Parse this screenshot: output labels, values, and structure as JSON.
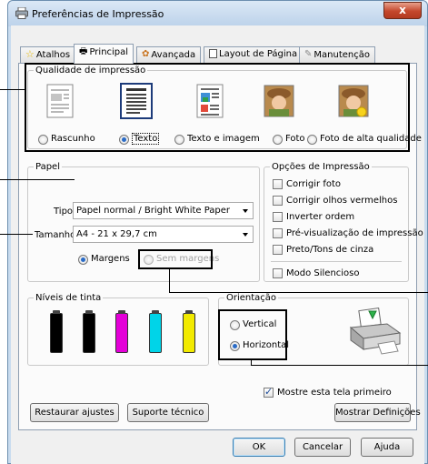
{
  "window": {
    "title": "Preferências de Impressão",
    "close": "x"
  },
  "tabs": [
    {
      "label": "Atalhos",
      "icon": "star-icon"
    },
    {
      "label": "Principal",
      "icon": "printer-icon"
    },
    {
      "label": "Avançada",
      "icon": "advanced-icon"
    },
    {
      "label": "Layout de Página",
      "icon": "page-layout-icon"
    },
    {
      "label": "Manutenção",
      "icon": "maintenance-icon"
    }
  ],
  "quality": {
    "legend": "Qualidade de impressão",
    "options": [
      {
        "label": "Rascunho",
        "selected": false
      },
      {
        "label": "Texto",
        "selected": true
      },
      {
        "label": "Texto e imagem",
        "selected": false
      },
      {
        "label": "Foto",
        "selected": false
      },
      {
        "label": "Foto de alta qualidade",
        "selected": false
      }
    ]
  },
  "paper": {
    "legend": "Papel",
    "type_label": "Tipo",
    "type_value": "Papel normal / Bright White Paper",
    "size_label": "Tamanho",
    "size_value": "A4 - 21 x 29,7 cm",
    "margins": "Margens",
    "no_margins": "Sem margens"
  },
  "print_options": {
    "legend": "Opções de Impressão",
    "items": [
      {
        "label": "Corrigir foto",
        "checked": false
      },
      {
        "label": "Corrigir olhos vermelhos",
        "checked": false
      },
      {
        "label": "Inverter ordem",
        "checked": false
      },
      {
        "label": "Pré-visualização de impressão",
        "checked": false
      },
      {
        "label": "Preto/Tons de cinza",
        "checked": false
      }
    ],
    "silent": {
      "label": "Modo Silencioso",
      "checked": false
    }
  },
  "ink": {
    "legend": "Níveis de tinta",
    "cartridges": [
      {
        "color": "#000000"
      },
      {
        "color": "#000000"
      },
      {
        "color": "#e400d8"
      },
      {
        "color": "#00d4e8"
      },
      {
        "color": "#f2ea00"
      }
    ]
  },
  "orientation": {
    "legend": "Orientação",
    "vertical": "Vertical",
    "horizontal": "Horizontal",
    "selected": "Horizontal"
  },
  "show_first": {
    "label": "Mostre esta tela primeiro",
    "checked": true
  },
  "buttons": {
    "restore": "Restaurar ajustes",
    "support": "Suporte técnico",
    "show_settings": "Mostrar Definições",
    "ok": "OK",
    "cancel": "Cancelar",
    "help": "Ajuda"
  }
}
